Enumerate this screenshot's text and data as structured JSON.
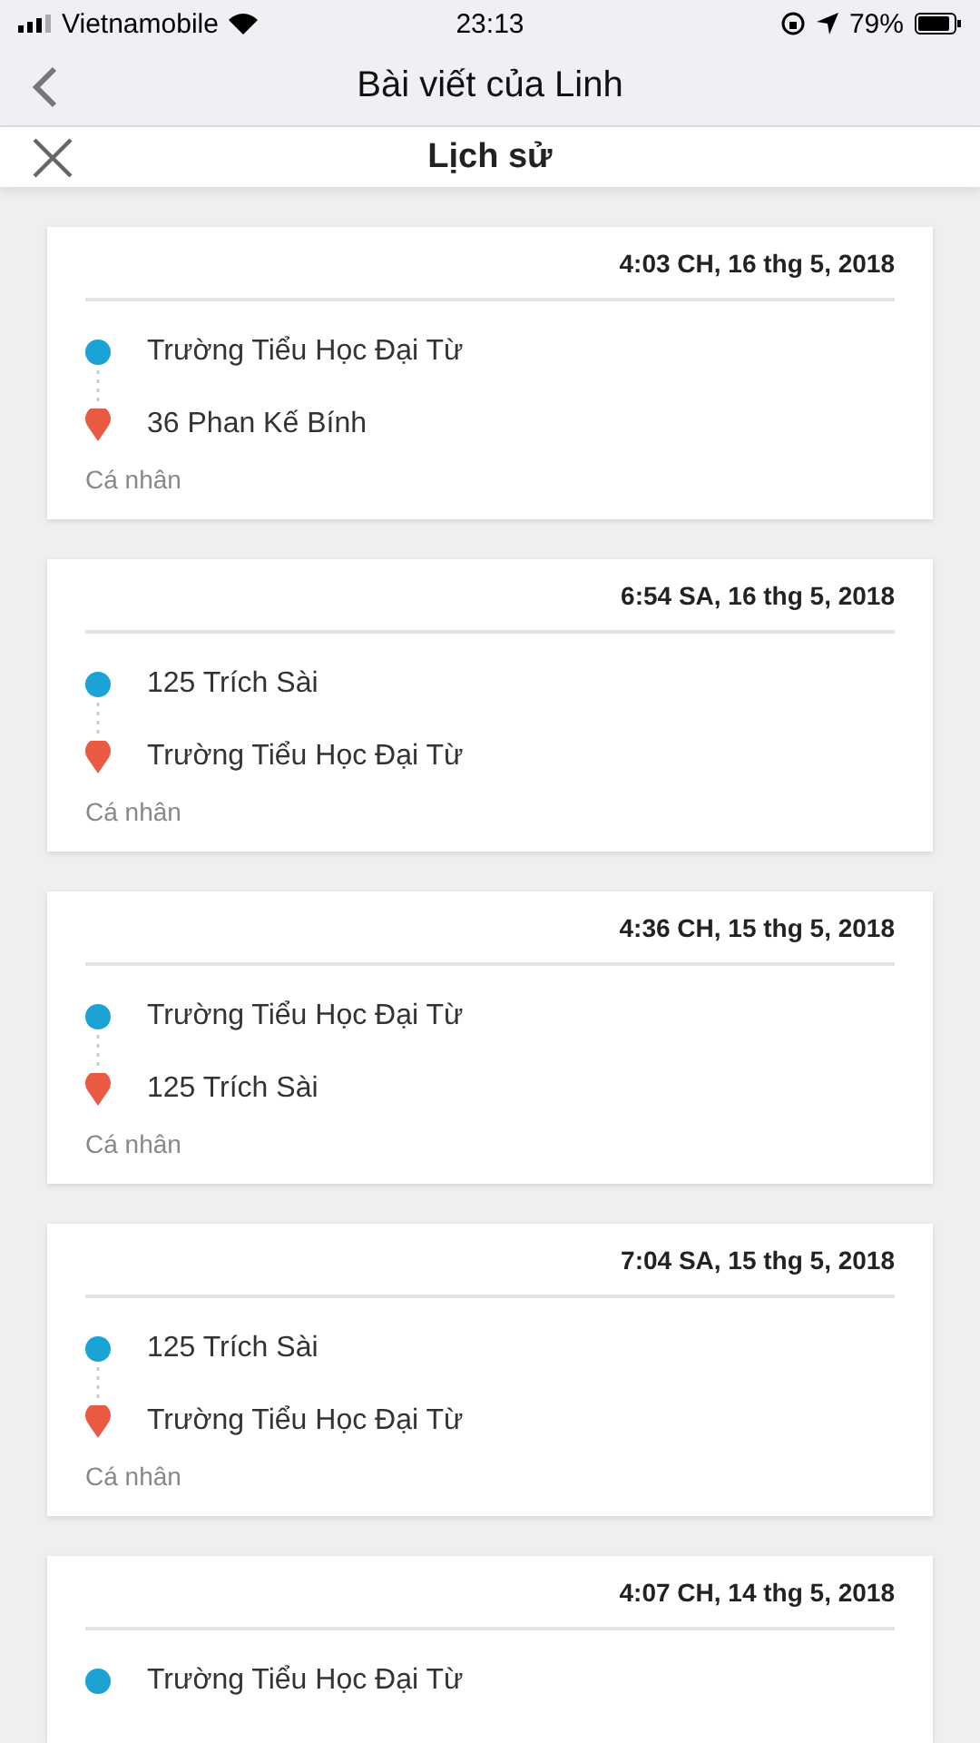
{
  "status_bar": {
    "carrier": "Vietnamobile",
    "time": "23:13",
    "battery": "79%"
  },
  "nav": {
    "title": "Bài viết của Linh"
  },
  "sheet": {
    "title": "Lịch sử"
  },
  "trips": [
    {
      "date": "4:03 CH, 16 thg 5, 2018",
      "origin": "Trường Tiểu Học Đại Từ",
      "destination": "36 Phan Kế Bính",
      "label": "Cá nhân"
    },
    {
      "date": "6:54 SA, 16 thg 5, 2018",
      "origin": "125 Trích Sài",
      "destination": "Trường Tiểu Học Đại Từ",
      "label": "Cá nhân"
    },
    {
      "date": "4:36 CH, 15 thg 5, 2018",
      "origin": "Trường Tiểu Học Đại Từ",
      "destination": "125 Trích Sài",
      "label": "Cá nhân"
    },
    {
      "date": "7:04 SA, 15 thg 5, 2018",
      "origin": "125 Trích Sài",
      "destination": "Trường Tiểu Học Đại Từ",
      "label": "Cá nhân"
    },
    {
      "date": "4:07 CH, 14 thg 5, 2018",
      "origin": "Trường Tiểu Học Đại Từ"
    }
  ]
}
